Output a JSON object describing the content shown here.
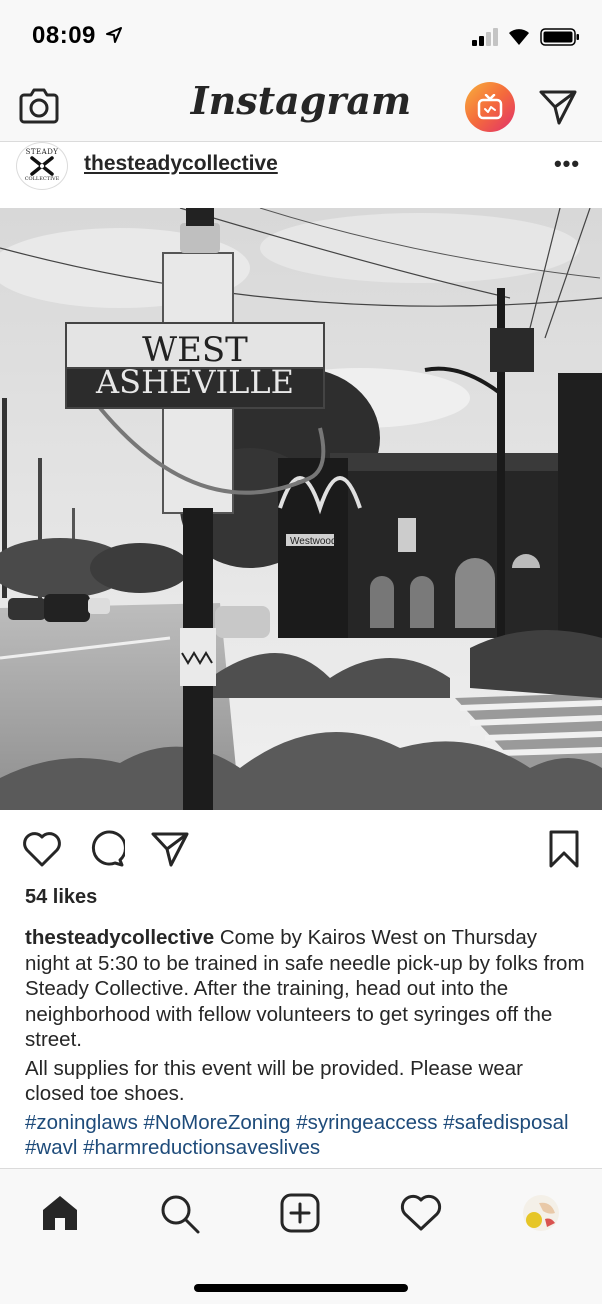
{
  "status_bar": {
    "time": "08:09"
  },
  "header": {
    "app_title": "Instagram"
  },
  "post": {
    "avatar_text_top": "STEADY",
    "avatar_text_bottom": "COLLECTIVE",
    "username": "thesteadycollective",
    "image_sign_line1": "WEST",
    "image_sign_line2": "ASHEVILLE",
    "image_small_sign": "Westwood",
    "likes": "54 likes",
    "caption_user": "thesteadycollective",
    "caption_text": "Come by Kairos West on Thursday night at 5:30 to be trained in safe needle pick-up by folks from Steady Collective. After the training, head out into the neighborhood with fellow volunteers to get syringes off the street.",
    "caption_text_2": "All supplies for this event will be provided. Please wear closed toe shoes.",
    "hashtags": "#zoninglaws #NoMoreZoning #syringeaccess #safedisposal #wavl #harmreductionsaveslives"
  },
  "colors": {
    "hashtag": "#1e4b7a",
    "igtv_gradient_start": "#f8b13d",
    "igtv_gradient_end": "#e1306c"
  },
  "icons": [
    "camera-icon",
    "igtv-icon",
    "direct-message-icon",
    "more-options-icon",
    "like-heart-icon",
    "comment-icon",
    "share-icon",
    "bookmark-icon",
    "home-icon",
    "search-icon",
    "new-post-icon",
    "activity-heart-icon",
    "profile-avatar"
  ]
}
